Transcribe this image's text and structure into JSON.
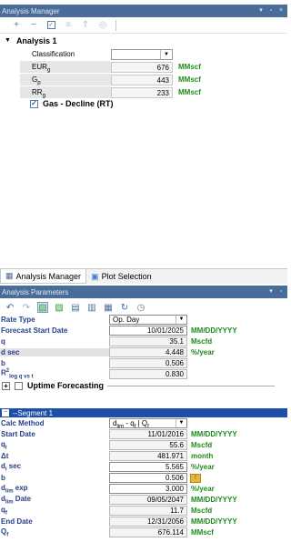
{
  "analysis_manager": {
    "title": "Analysis Manager",
    "title_icons": [
      "pin-icon",
      "float-icon",
      "close-icon"
    ],
    "toolbar_icons": [
      "add-icon",
      "remove-icon",
      "check-icon",
      "collapse-icon",
      "expand-icon",
      "target-icon"
    ],
    "tree_root": "Analysis 1",
    "props": [
      {
        "label": "Classification",
        "value": "",
        "unit": ""
      },
      {
        "label_main": "EUR",
        "label_sub": "g",
        "value": "676",
        "unit": "MMscf"
      },
      {
        "label_main": "G",
        "label_sub": "p",
        "value": "443",
        "unit": "MMscf"
      },
      {
        "label_main": "RR",
        "label_sub": "g",
        "value": "233",
        "unit": "MMscf"
      }
    ],
    "decline_item": "Gas - Decline (RT)",
    "decline_checked": "✓"
  },
  "tabs": [
    {
      "label": "Analysis Manager",
      "icon": "grid-icon"
    },
    {
      "label": "Plot Selection",
      "icon": "plot-icon"
    }
  ],
  "analysis_parameters": {
    "title": "Analysis Parameters",
    "rows": [
      {
        "label": "Rate Type",
        "value": "Op. Day",
        "unit": ""
      },
      {
        "label": "Forecast Start Date",
        "value": "10/01/2025",
        "unit": "MM/DD/YYYY"
      },
      {
        "label": "q",
        "value": "35.1",
        "unit": "Mscfd"
      },
      {
        "label": "d sec",
        "value": "4.448",
        "unit": "%/year"
      },
      {
        "label": "b",
        "value": "0.506",
        "unit": ""
      },
      {
        "label_main": "R",
        "label_sup": "2",
        "label_sub": "log q vs t",
        "value": "0.830",
        "unit": ""
      }
    ],
    "uptime_label": "Uptime Forecasting",
    "segment_title": "Segment 1",
    "segment_rows": [
      {
        "label": "Calc Method",
        "value": "d",
        "value_sub": "lim",
        "value_rest": " - q",
        "value_sub2": "f",
        "value_rest2": " | Q",
        "value_sub3": "f",
        "unit": ""
      },
      {
        "label": "Start Date",
        "value": "11/01/2016",
        "unit": "MM/DD/YYYY"
      },
      {
        "label_main": "q",
        "label_sub": "i",
        "value": "55.6",
        "unit": "Mscfd"
      },
      {
        "label": "Δt",
        "value": "481.971",
        "unit": "month"
      },
      {
        "label_main": "d",
        "label_sub": "i",
        "label_rest": " sec",
        "value": "5.565",
        "unit": "%/year"
      },
      {
        "label": "b",
        "value": "0.506",
        "unit": ""
      },
      {
        "label_main": "d",
        "label_sub": "lim",
        "label_rest": " exp",
        "value": "3.000",
        "unit": "%/year"
      },
      {
        "label_main": "d",
        "label_sub": "lim",
        "label_rest": " Date",
        "value": "09/05/2047",
        "unit": "MM/DD/YYYY"
      },
      {
        "label_main": "q",
        "label_sub": "f",
        "value": "11.7",
        "unit": "Mscfd"
      },
      {
        "label": "End Date",
        "value": "12/31/2056",
        "unit": "MM/DD/YYYY"
      },
      {
        "label_main": "Q",
        "label_sub": "f",
        "value": "676.114",
        "unit": "MMscf"
      }
    ]
  }
}
